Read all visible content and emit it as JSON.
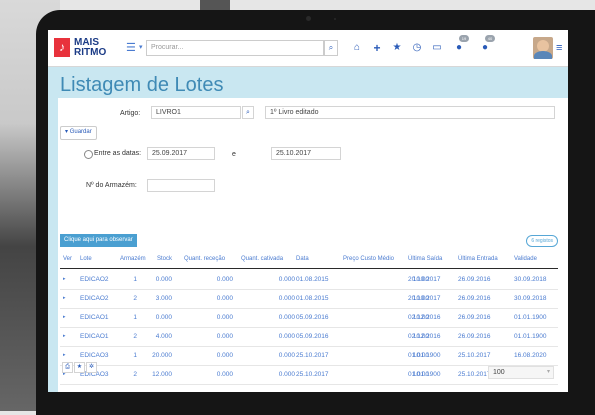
{
  "header": {
    "logo_line1": "MAIS",
    "logo_line2": "RITMO",
    "search_placeholder": "Procurar...",
    "badge1": "19",
    "badge2": "40"
  },
  "page": {
    "title": "Listagem de Lotes"
  },
  "form": {
    "artigo_label": "Artigo:",
    "artigo_value": "LIVRO1",
    "artigo_desc": "1º Livro editado",
    "guardar_label": "Guardar",
    "entre_datas_label": "Entre as datas:",
    "date_from": "25.09.2017",
    "date_sep": "e",
    "date_to": "25.10.2017",
    "armazem_label": "Nº do Armazém:",
    "armazem_value": ""
  },
  "observe_button": "Clique aqui para observar",
  "records_badge": "6 registos",
  "table": {
    "columns": [
      "Ver",
      "Lote",
      "Armazém",
      "Stock",
      "Quant. receção",
      "Quant. cativada",
      "Data",
      "Preço Custo Médio",
      "Última Saída",
      "Última Entrada",
      "Validade"
    ],
    "rows": [
      [
        "EDICAO2",
        "1",
        "0.000",
        "0.000",
        "0.000",
        "01.08.2015",
        "10.00",
        "20.10.2017",
        "26.09.2016",
        "30.09.2018"
      ],
      [
        "EDICAO2",
        "2",
        "3.000",
        "0.000",
        "0.000",
        "01.08.2015",
        "10.00",
        "20.10.2017",
        "26.09.2016",
        "30.09.2018"
      ],
      [
        "EDICAO1",
        "1",
        "0.000",
        "0.000",
        "0.000",
        "05.09.2016",
        "10.00",
        "02.12.2016",
        "26.09.2016",
        "01.01.1900"
      ],
      [
        "EDICAO1",
        "2",
        "4.000",
        "0.000",
        "0.000",
        "05.09.2016",
        "10.00",
        "02.12.2016",
        "26.09.2016",
        "01.01.1900"
      ],
      [
        "EDICAO3",
        "1",
        "20.000",
        "0.000",
        "0.000",
        "25.10.2017",
        "10.00",
        "01.01.1900",
        "25.10.2017",
        "16.08.2020"
      ],
      [
        "EDICAO3",
        "2",
        "12.000",
        "0.000",
        "0.000",
        "25.10.2017",
        "10.00",
        "01.01.1900",
        "25.10.2017",
        "16.08.2020"
      ]
    ]
  },
  "footer": {
    "page_size": "100"
  },
  "icons": {
    "logo": "music-note-icon",
    "menu": "list-icon",
    "search": "search-icon",
    "nav": [
      "home-icon",
      "plus-icon",
      "star-icon",
      "clock-icon",
      "calendar-icon",
      "chat-icon",
      "notification-icon"
    ],
    "footer": [
      "print-icon",
      "star-icon",
      "gear-icon"
    ]
  },
  "colors": {
    "accent": "#3f8ab5",
    "link": "#4a7bd0",
    "brand_red": "#e8323c",
    "background": "#c9e7f1"
  }
}
